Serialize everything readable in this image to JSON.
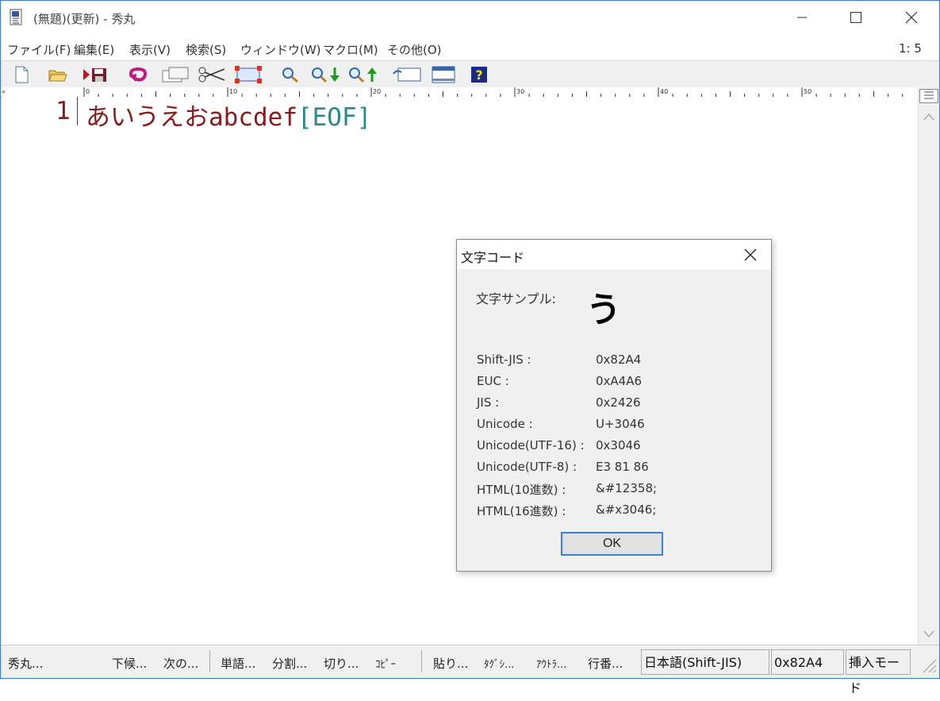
{
  "window": {
    "title": "(無題)(更新) - 秀丸"
  },
  "menu": {
    "items": [
      "ファイル(F)",
      "編集(E)",
      "表示(V)",
      "検索(S)",
      "ウィンドウ(W)",
      "マクロ(M)",
      "その他(O)"
    ],
    "position": "1: 5"
  },
  "toolbar": {
    "icons": [
      "new-file-icon",
      "open-folder-icon",
      "save-icon",
      "undo-icon",
      "copy-icon",
      "cut-icon",
      "paste-icon",
      "search-icon",
      "search-next-icon",
      "search-prev-icon",
      "window-icon",
      "window-list-icon",
      "help-icon"
    ]
  },
  "ruler": {
    "marks": [
      "0",
      "10",
      "20",
      "30",
      "40",
      "50"
    ]
  },
  "editor": {
    "line_number": "1",
    "text": "あいうえおabcdef",
    "eof": "[EOF]"
  },
  "dialog": {
    "title": "文字コード",
    "sample_label": "文字サンプル:",
    "sample_char": "う",
    "rows": [
      {
        "key": "Shift-JIS :",
        "value": "0x82A4"
      },
      {
        "key": "EUC :",
        "value": "0xA4A6"
      },
      {
        "key": "JIS :",
        "value": "0x2426"
      },
      {
        "key": "Unicode :",
        "value": "U+3046"
      },
      {
        "key": "Unicode(UTF-16) :",
        "value": "0x3046"
      },
      {
        "key": "Unicode(UTF-8) :",
        "value": "E3 81 86"
      },
      {
        "key": "HTML(10進数) :",
        "value": "&#12358;"
      },
      {
        "key": "HTML(16進数) :",
        "value": "&#x3046;"
      }
    ],
    "ok_label": "OK"
  },
  "statusbar": {
    "buttons": [
      "秀丸...",
      "下候...",
      "次の...",
      "単語...",
      "分割...",
      "切り...",
      "ｺﾋﾟｰ",
      "貼り...",
      "ﾀｸﾞｼ...",
      "ｱｳﾄﾗ...",
      "行番..."
    ],
    "encoding": "日本語(Shift-JIS)",
    "char_code": "0x82A4",
    "mode": "挿入モード"
  }
}
